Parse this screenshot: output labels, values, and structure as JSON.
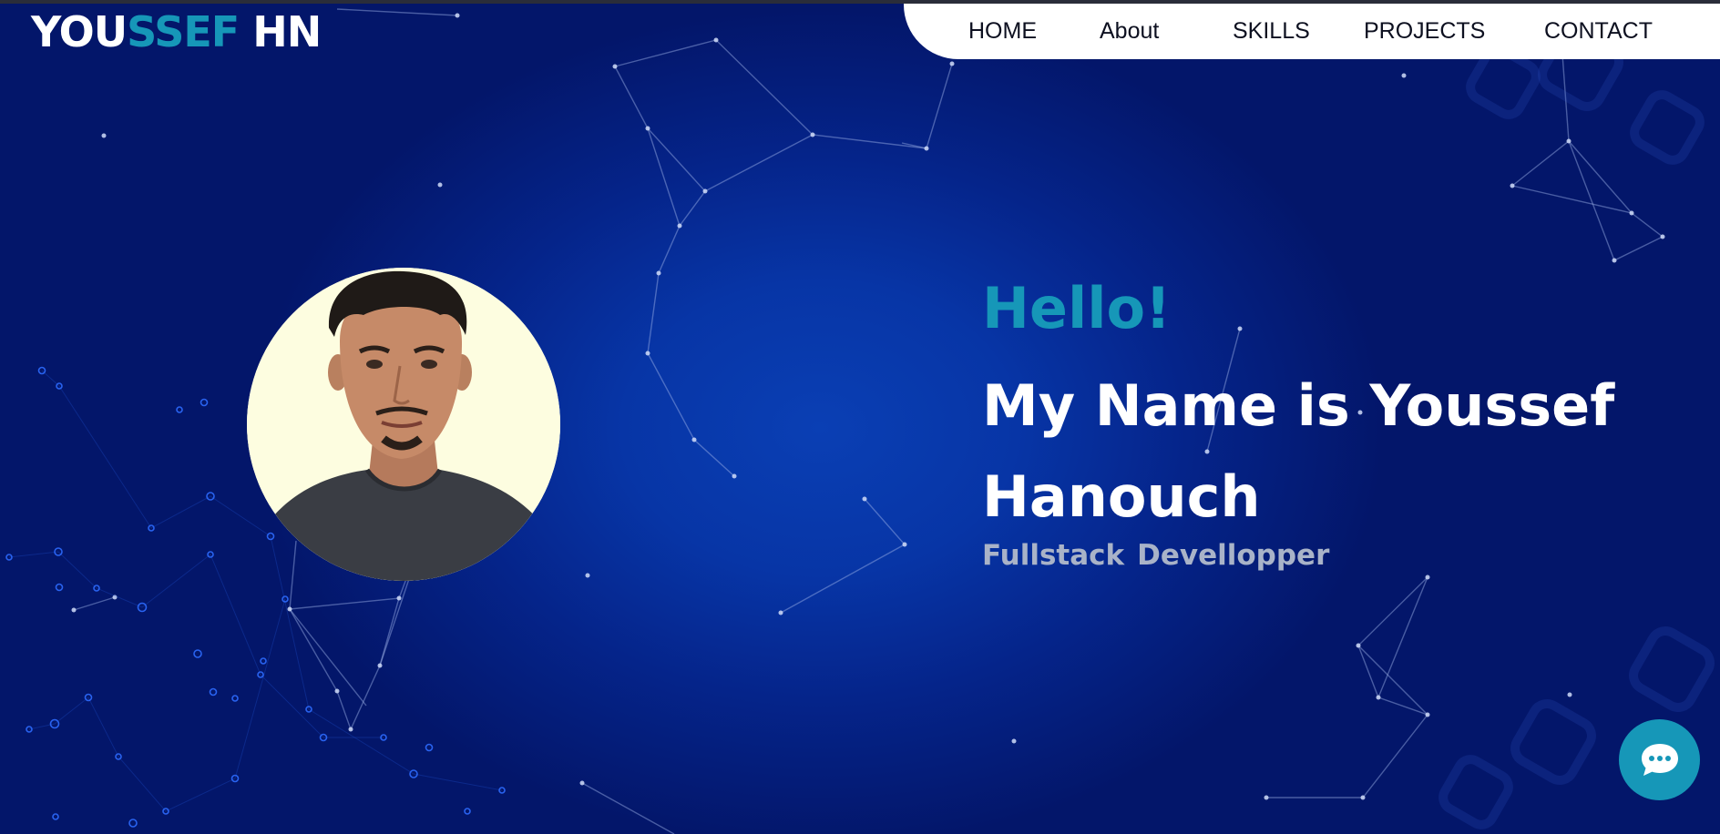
{
  "logo": {
    "part1": "YOU",
    "part2": "SSEF",
    "part3": " HN"
  },
  "nav": {
    "items": [
      "HOME",
      "About",
      "SKILLS",
      "PROJECTS",
      "CONTACT"
    ]
  },
  "hero": {
    "greeting": "Hello!",
    "name_line": "My Name is  Youssef Hanouch",
    "role_word1": "Fullstack",
    "role_word2": "Devellopper"
  },
  "avatar": {
    "alt": "Profile photo"
  },
  "chat": {
    "icon": "chat-bubble-icon"
  },
  "colors": {
    "accent": "#1697b8",
    "background": "#0735a6",
    "nav_bg": "#ffffff"
  }
}
